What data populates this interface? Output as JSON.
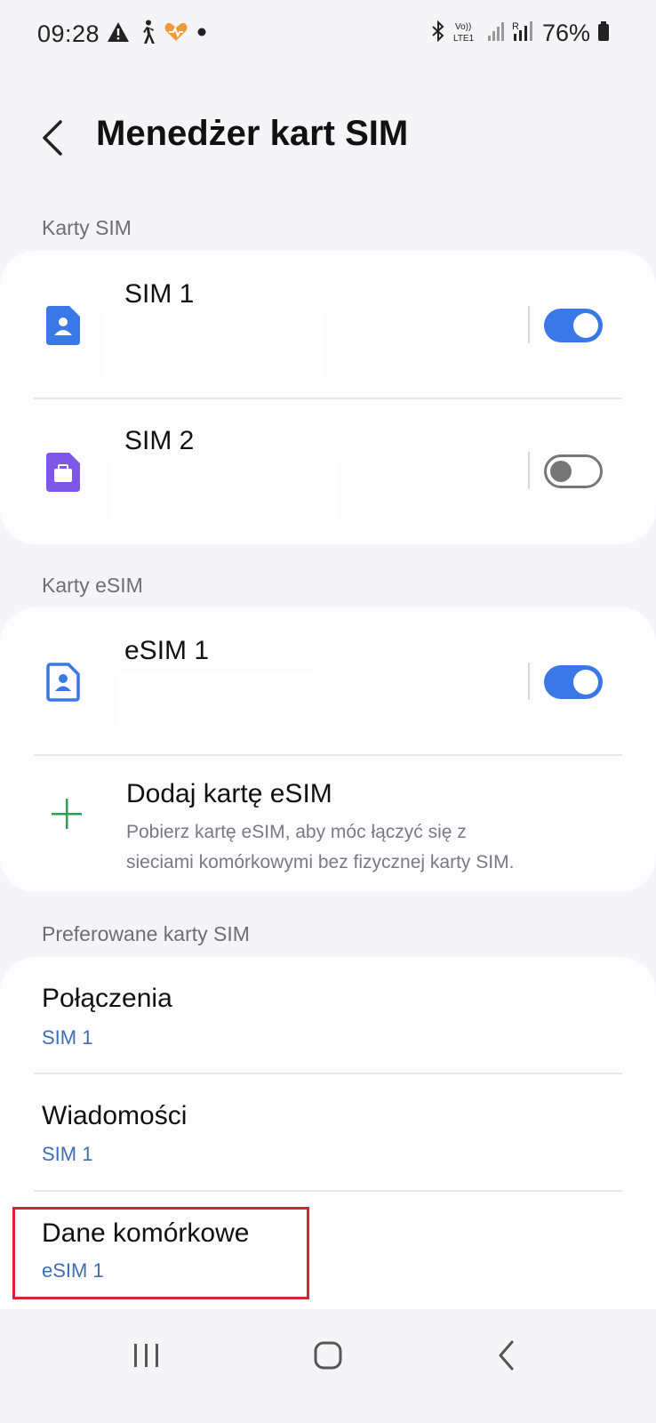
{
  "status_bar": {
    "time": "09:28",
    "battery": "76%",
    "left_icons": [
      "warning-icon",
      "walking-icon",
      "health-heart-icon",
      "dot-icon"
    ],
    "right_icons": [
      "bluetooth-icon",
      "volte-icon",
      "signal-icon",
      "roaming-signal-icon",
      "battery-icon"
    ],
    "volte_label_top": "Vo))",
    "volte_label_bottom": "LTE1",
    "roaming_label": "R"
  },
  "header": {
    "title": "Menedżer kart SIM"
  },
  "sections": {
    "sim_cards_header": "Karty SIM",
    "esim_header": "Karty eSIM",
    "preferred_header": "Preferowane karty SIM"
  },
  "sim_cards": [
    {
      "name": "SIM 1",
      "icon": "sim-person-icon",
      "color": "#3b78e7",
      "enabled": true
    },
    {
      "name": "SIM 2",
      "icon": "sim-briefcase-icon",
      "color": "#7e57e6",
      "enabled": false
    }
  ],
  "esim_cards": [
    {
      "name": "eSIM 1",
      "icon": "esim-person-icon",
      "color": "#3b78e7",
      "enabled": true
    }
  ],
  "add_esim": {
    "title": "Dodaj kartę eSIM",
    "desc_line1": "Pobierz kartę eSIM, aby móc łączyć się z",
    "desc_line2": "sieciami komórkowymi bez fizycznej karty SIM.",
    "icon": "plus-icon",
    "icon_color": "#2e9e4f"
  },
  "preferred": [
    {
      "title": "Połączenia",
      "value": "SIM 1"
    },
    {
      "title": "Wiadomości",
      "value": "SIM 1"
    },
    {
      "title": "Dane komórkowe",
      "value": "eSIM 1",
      "highlighted": true
    }
  ],
  "nav_bar": {
    "icons": [
      "recent-apps-icon",
      "home-icon",
      "back-nav-icon"
    ]
  },
  "colors": {
    "accent": "#3b78e7",
    "link_text": "#3d6fb7",
    "highlight": "#d9232e",
    "background": "#f5f5f8"
  }
}
